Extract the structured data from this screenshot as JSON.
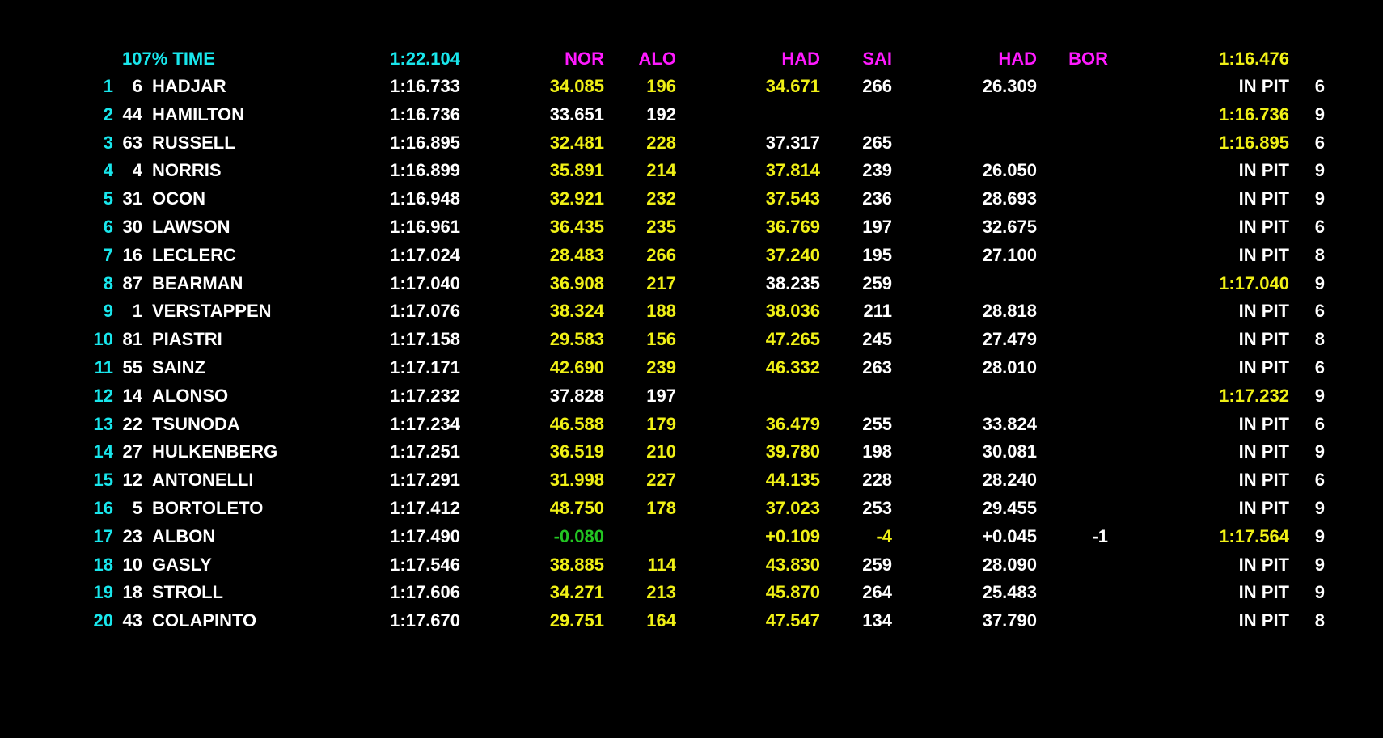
{
  "header": {
    "label": "107% TIME",
    "time": "1:22.104",
    "s1_leader": "NOR",
    "s1_second": "ALO",
    "s2_leader": "HAD",
    "s2_second": "SAI",
    "s3_leader": "HAD",
    "s3_second": "BOR",
    "best_time": "1:16.476"
  },
  "colors": {
    "cyan": "#19e6ec",
    "white": "#ffffff",
    "yellow": "#f0f016",
    "magenta": "#ff1aff",
    "green": "#22c422"
  },
  "rows": [
    {
      "pos": "1",
      "num": "6",
      "name": "HADJAR",
      "time": "1:16.733",
      "s1": "34.085",
      "s1c": "yellow",
      "s1d": "196",
      "s1dc": "yellow",
      "s2": "34.671",
      "s2c": "yellow",
      "s2d": "266",
      "s2dc": "white",
      "s3": "26.309",
      "s3c": "white",
      "s3d": "",
      "s3dc": "white",
      "last": "IN PIT",
      "lastc": "white",
      "laps": "6"
    },
    {
      "pos": "2",
      "num": "44",
      "name": "HAMILTON",
      "time": "1:16.736",
      "s1": "33.651",
      "s1c": "white",
      "s1d": "192",
      "s1dc": "white",
      "s2": "",
      "s2c": "white",
      "s2d": "",
      "s2dc": "white",
      "s3": "",
      "s3c": "white",
      "s3d": "",
      "s3dc": "white",
      "last": "1:16.736",
      "lastc": "yellow",
      "laps": "9"
    },
    {
      "pos": "3",
      "num": "63",
      "name": "RUSSELL",
      "time": "1:16.895",
      "s1": "32.481",
      "s1c": "yellow",
      "s1d": "228",
      "s1dc": "yellow",
      "s2": "37.317",
      "s2c": "white",
      "s2d": "265",
      "s2dc": "white",
      "s3": "",
      "s3c": "white",
      "s3d": "",
      "s3dc": "white",
      "last": "1:16.895",
      "lastc": "yellow",
      "laps": "6"
    },
    {
      "pos": "4",
      "num": "4",
      "name": "NORRIS",
      "time": "1:16.899",
      "s1": "35.891",
      "s1c": "yellow",
      "s1d": "214",
      "s1dc": "yellow",
      "s2": "37.814",
      "s2c": "yellow",
      "s2d": "239",
      "s2dc": "white",
      "s3": "26.050",
      "s3c": "white",
      "s3d": "",
      "s3dc": "white",
      "last": "IN PIT",
      "lastc": "white",
      "laps": "9"
    },
    {
      "pos": "5",
      "num": "31",
      "name": "OCON",
      "time": "1:16.948",
      "s1": "32.921",
      "s1c": "yellow",
      "s1d": "232",
      "s1dc": "yellow",
      "s2": "37.543",
      "s2c": "yellow",
      "s2d": "236",
      "s2dc": "white",
      "s3": "28.693",
      "s3c": "white",
      "s3d": "",
      "s3dc": "white",
      "last": "IN PIT",
      "lastc": "white",
      "laps": "9"
    },
    {
      "pos": "6",
      "num": "30",
      "name": "LAWSON",
      "time": "1:16.961",
      "s1": "36.435",
      "s1c": "yellow",
      "s1d": "235",
      "s1dc": "yellow",
      "s2": "36.769",
      "s2c": "yellow",
      "s2d": "197",
      "s2dc": "white",
      "s3": "32.675",
      "s3c": "white",
      "s3d": "",
      "s3dc": "white",
      "last": "IN PIT",
      "lastc": "white",
      "laps": "6"
    },
    {
      "pos": "7",
      "num": "16",
      "name": "LECLERC",
      "time": "1:17.024",
      "s1": "28.483",
      "s1c": "yellow",
      "s1d": "266",
      "s1dc": "yellow",
      "s2": "37.240",
      "s2c": "yellow",
      "s2d": "195",
      "s2dc": "white",
      "s3": "27.100",
      "s3c": "white",
      "s3d": "",
      "s3dc": "white",
      "last": "IN PIT",
      "lastc": "white",
      "laps": "8"
    },
    {
      "pos": "8",
      "num": "87",
      "name": "BEARMAN",
      "time": "1:17.040",
      "s1": "36.908",
      "s1c": "yellow",
      "s1d": "217",
      "s1dc": "yellow",
      "s2": "38.235",
      "s2c": "white",
      "s2d": "259",
      "s2dc": "white",
      "s3": "",
      "s3c": "white",
      "s3d": "",
      "s3dc": "white",
      "last": "1:17.040",
      "lastc": "yellow",
      "laps": "9"
    },
    {
      "pos": "9",
      "num": "1",
      "name": "VERSTAPPEN",
      "time": "1:17.076",
      "s1": "38.324",
      "s1c": "yellow",
      "s1d": "188",
      "s1dc": "yellow",
      "s2": "38.036",
      "s2c": "yellow",
      "s2d": "211",
      "s2dc": "white",
      "s3": "28.818",
      "s3c": "white",
      "s3d": "",
      "s3dc": "white",
      "last": "IN PIT",
      "lastc": "white",
      "laps": "6"
    },
    {
      "pos": "10",
      "num": "81",
      "name": "PIASTRI",
      "time": "1:17.158",
      "s1": "29.583",
      "s1c": "yellow",
      "s1d": "156",
      "s1dc": "yellow",
      "s2": "47.265",
      "s2c": "yellow",
      "s2d": "245",
      "s2dc": "white",
      "s3": "27.479",
      "s3c": "white",
      "s3d": "",
      "s3dc": "white",
      "last": "IN PIT",
      "lastc": "white",
      "laps": "8"
    },
    {
      "pos": "11",
      "num": "55",
      "name": "SAINZ",
      "time": "1:17.171",
      "s1": "42.690",
      "s1c": "yellow",
      "s1d": "239",
      "s1dc": "yellow",
      "s2": "46.332",
      "s2c": "yellow",
      "s2d": "263",
      "s2dc": "white",
      "s3": "28.010",
      "s3c": "white",
      "s3d": "",
      "s3dc": "white",
      "last": "IN PIT",
      "lastc": "white",
      "laps": "6"
    },
    {
      "pos": "12",
      "num": "14",
      "name": "ALONSO",
      "time": "1:17.232",
      "s1": "37.828",
      "s1c": "white",
      "s1d": "197",
      "s1dc": "white",
      "s2": "",
      "s2c": "white",
      "s2d": "",
      "s2dc": "white",
      "s3": "",
      "s3c": "white",
      "s3d": "",
      "s3dc": "white",
      "last": "1:17.232",
      "lastc": "yellow",
      "laps": "9"
    },
    {
      "pos": "13",
      "num": "22",
      "name": "TSUNODA",
      "time": "1:17.234",
      "s1": "46.588",
      "s1c": "yellow",
      "s1d": "179",
      "s1dc": "yellow",
      "s2": "36.479",
      "s2c": "yellow",
      "s2d": "255",
      "s2dc": "white",
      "s3": "33.824",
      "s3c": "white",
      "s3d": "",
      "s3dc": "white",
      "last": "IN PIT",
      "lastc": "white",
      "laps": "6"
    },
    {
      "pos": "14",
      "num": "27",
      "name": "HULKENBERG",
      "time": "1:17.251",
      "s1": "36.519",
      "s1c": "yellow",
      "s1d": "210",
      "s1dc": "yellow",
      "s2": "39.780",
      "s2c": "yellow",
      "s2d": "198",
      "s2dc": "white",
      "s3": "30.081",
      "s3c": "white",
      "s3d": "",
      "s3dc": "white",
      "last": "IN PIT",
      "lastc": "white",
      "laps": "9"
    },
    {
      "pos": "15",
      "num": "12",
      "name": "ANTONELLI",
      "time": "1:17.291",
      "s1": "31.998",
      "s1c": "yellow",
      "s1d": "227",
      "s1dc": "yellow",
      "s2": "44.135",
      "s2c": "yellow",
      "s2d": "228",
      "s2dc": "white",
      "s3": "28.240",
      "s3c": "white",
      "s3d": "",
      "s3dc": "white",
      "last": "IN PIT",
      "lastc": "white",
      "laps": "6"
    },
    {
      "pos": "16",
      "num": "5",
      "name": "BORTOLETO",
      "time": "1:17.412",
      "s1": "48.750",
      "s1c": "yellow",
      "s1d": "178",
      "s1dc": "yellow",
      "s2": "37.023",
      "s2c": "yellow",
      "s2d": "253",
      "s2dc": "white",
      "s3": "29.455",
      "s3c": "white",
      "s3d": "",
      "s3dc": "white",
      "last": "IN PIT",
      "lastc": "white",
      "laps": "9"
    },
    {
      "pos": "17",
      "num": "23",
      "name": "ALBON",
      "time": "1:17.490",
      "s1": "-0.080",
      "s1c": "green",
      "s1d": "",
      "s1dc": "white",
      "s2": "+0.109",
      "s2c": "yellow",
      "s2d": "-4",
      "s2dc": "yellow",
      "s3": "+0.045",
      "s3c": "white",
      "s3d": "-1",
      "s3dc": "white",
      "last": "1:17.564",
      "lastc": "yellow",
      "laps": "9"
    },
    {
      "pos": "18",
      "num": "10",
      "name": "GASLY",
      "time": "1:17.546",
      "s1": "38.885",
      "s1c": "yellow",
      "s1d": "114",
      "s1dc": "yellow",
      "s2": "43.830",
      "s2c": "yellow",
      "s2d": "259",
      "s2dc": "white",
      "s3": "28.090",
      "s3c": "white",
      "s3d": "",
      "s3dc": "white",
      "last": "IN PIT",
      "lastc": "white",
      "laps": "9"
    },
    {
      "pos": "19",
      "num": "18",
      "name": "STROLL",
      "time": "1:17.606",
      "s1": "34.271",
      "s1c": "yellow",
      "s1d": "213",
      "s1dc": "yellow",
      "s2": "45.870",
      "s2c": "yellow",
      "s2d": "264",
      "s2dc": "white",
      "s3": "25.483",
      "s3c": "white",
      "s3d": "",
      "s3dc": "white",
      "last": "IN PIT",
      "lastc": "white",
      "laps": "9"
    },
    {
      "pos": "20",
      "num": "43",
      "name": "COLAPINTO",
      "time": "1:17.670",
      "s1": "29.751",
      "s1c": "yellow",
      "s1d": "164",
      "s1dc": "yellow",
      "s2": "47.547",
      "s2c": "yellow",
      "s2d": "134",
      "s2dc": "white",
      "s3": "37.790",
      "s3c": "white",
      "s3d": "",
      "s3dc": "white",
      "last": "IN PIT",
      "lastc": "white",
      "laps": "8"
    }
  ]
}
